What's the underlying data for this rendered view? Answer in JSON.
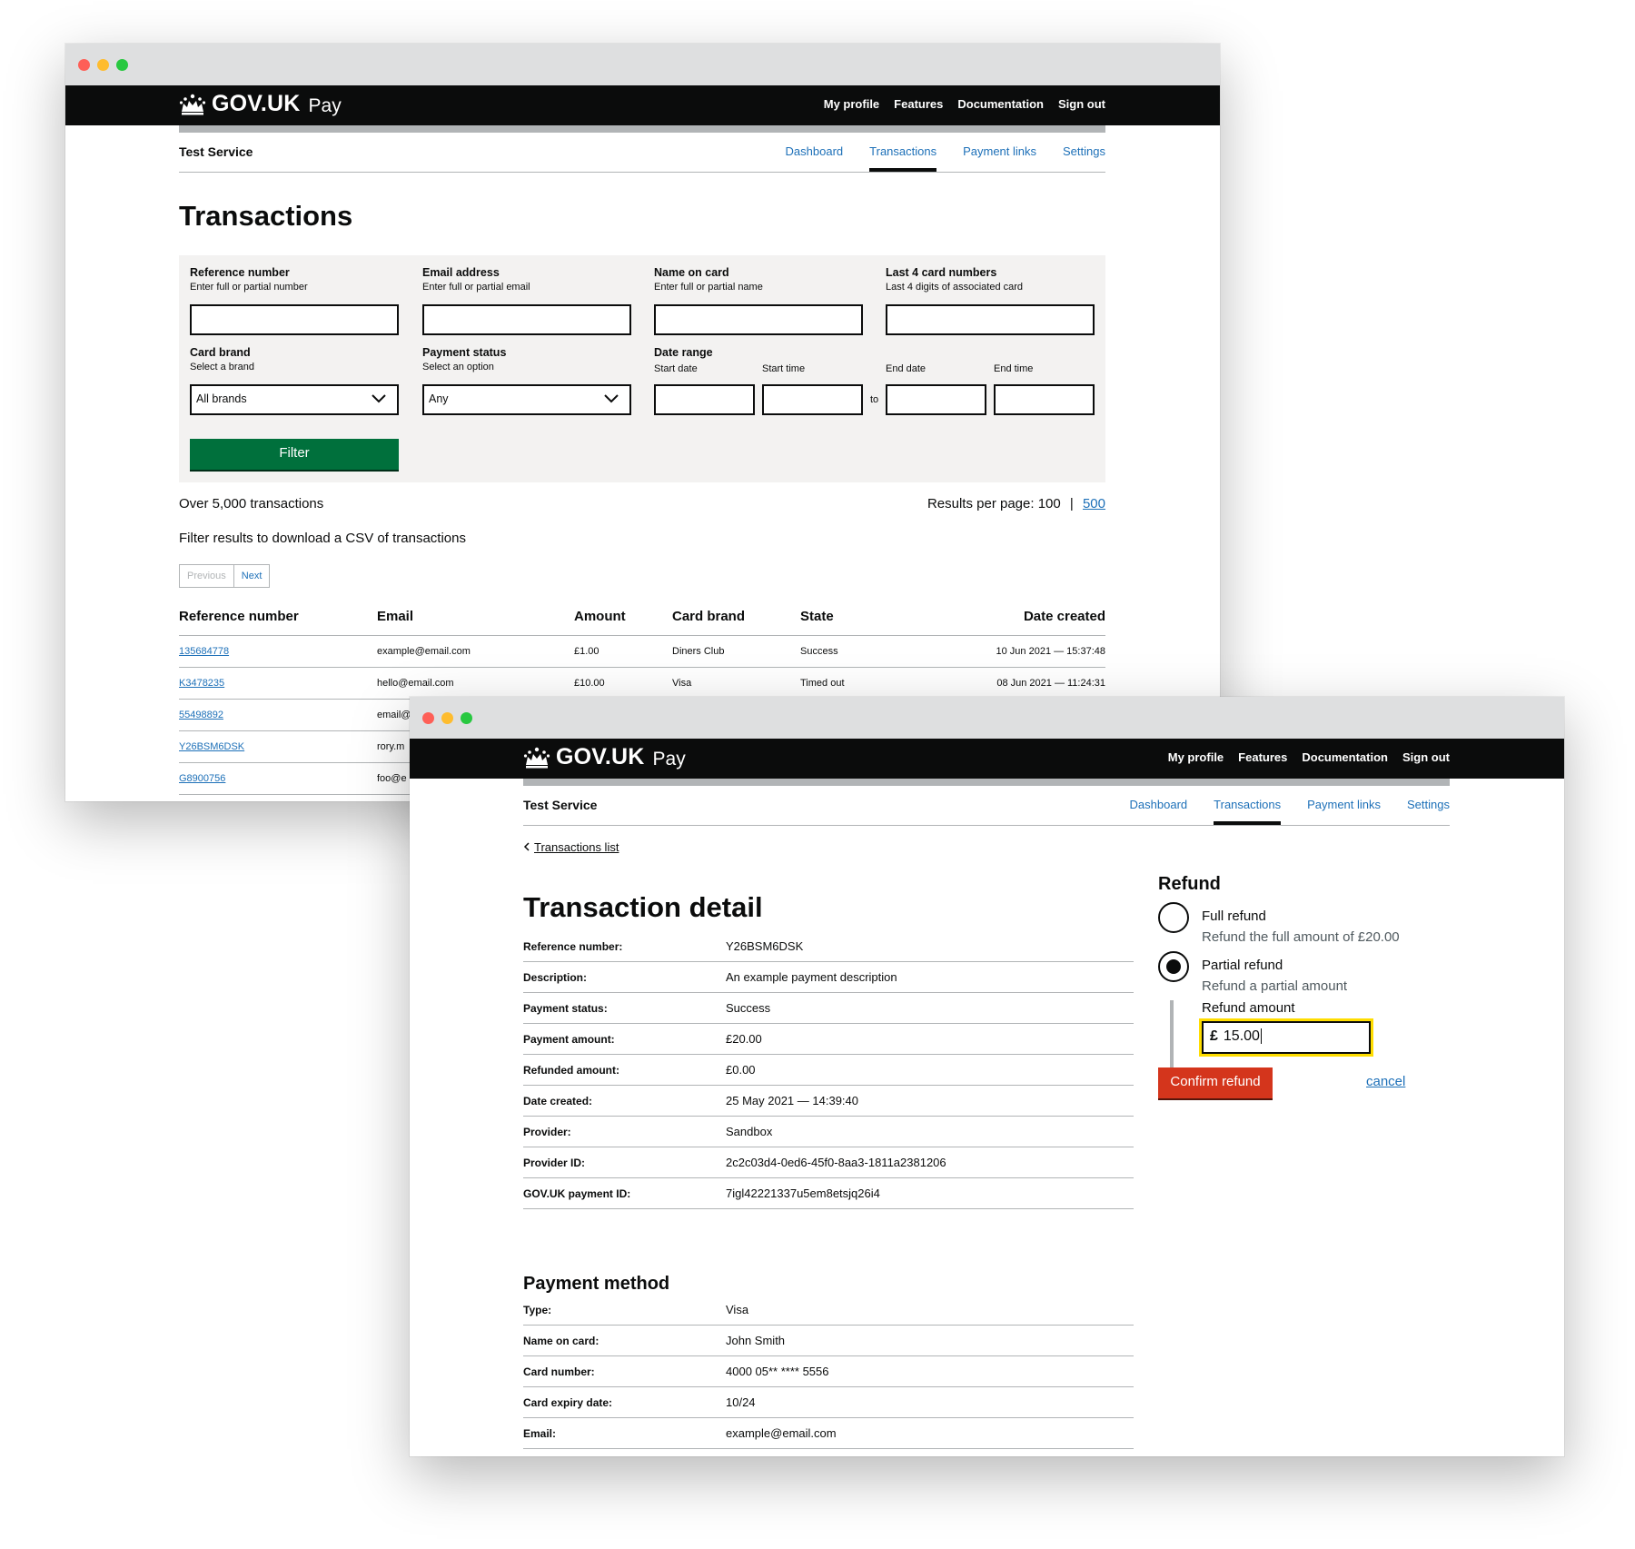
{
  "colors": {
    "gov_black": "#0b0c0c",
    "link_blue": "#1d70b8",
    "filter_green": "#00703c",
    "refund_red": "#d4351c",
    "focus_yellow": "#ffdd00",
    "panel_grey": "#f3f2f1"
  },
  "header": {
    "logo_text": "GOV.UK",
    "product_text": "Pay",
    "nav": [
      "My profile",
      "Features",
      "Documentation",
      "Sign out"
    ]
  },
  "service": {
    "name": "Test Service",
    "tabs": [
      "Dashboard",
      "Transactions",
      "Payment links",
      "Settings"
    ],
    "active_tab": "Transactions"
  },
  "transactions_page": {
    "title": "Transactions",
    "filters": {
      "reference": {
        "label": "Reference number",
        "hint": "Enter full or partial number",
        "value": ""
      },
      "email": {
        "label": "Email address",
        "hint": "Enter full or partial email",
        "value": ""
      },
      "name": {
        "label": "Name on card",
        "hint": "Enter full or partial name",
        "value": ""
      },
      "last4": {
        "label": "Last 4 card numbers",
        "hint": "Last 4 digits of associated card",
        "value": ""
      },
      "card_brand": {
        "label": "Card brand",
        "hint": "Select a brand",
        "selected": "All brands"
      },
      "payment_status": {
        "label": "Payment status",
        "hint": "Select an option",
        "selected": "Any"
      },
      "date_range": {
        "label": "Date range",
        "start_date": "Start date",
        "start_time": "Start time",
        "end_date": "End date",
        "end_time": "End time",
        "separator": "to"
      },
      "button": "Filter"
    },
    "count_text": "Over 5,000 transactions",
    "per_page_text": "Results per page: 100",
    "per_page_sep": "|",
    "per_page_alt": "500",
    "csv_text": "Filter results to download a CSV of transactions",
    "pager": {
      "previous": "Previous",
      "next": "Next"
    },
    "table": {
      "headers": [
        "Reference number",
        "Email",
        "Amount",
        "Card brand",
        "State",
        "Date created"
      ],
      "rows": [
        {
          "ref": "135684778",
          "email": "example@email.com",
          "amount": "£1.00",
          "brand": "Diners Club",
          "state": "Success",
          "date": "10 Jun 2021 — 15:37:48"
        },
        {
          "ref": "K3478235",
          "email": "hello@email.com",
          "amount": "£10.00",
          "brand": "Visa",
          "state": "Timed out",
          "date": "08 Jun 2021 — 11:24:31"
        },
        {
          "ref": "55498892",
          "email": "email@",
          "amount": "",
          "brand": "",
          "state": "",
          "date": ""
        },
        {
          "ref": "Y26BSM6DSK",
          "email": "rory.m",
          "amount": "",
          "brand": "",
          "state": "",
          "date": ""
        },
        {
          "ref": "G8900756",
          "email": "foo@e",
          "amount": "",
          "brand": "",
          "state": "",
          "date": ""
        }
      ]
    }
  },
  "detail_page": {
    "back_link": "Transactions list",
    "title": "Transaction detail",
    "rows": [
      {
        "k": "Reference number:",
        "v": "Y26BSM6DSK"
      },
      {
        "k": "Description:",
        "v": "An example payment description"
      },
      {
        "k": "Payment status:",
        "v": "Success"
      },
      {
        "k": "Payment amount:",
        "v": "£20.00"
      },
      {
        "k": "Refunded amount:",
        "v": "£0.00"
      },
      {
        "k": "Date created:",
        "v": "25 May 2021 — 14:39:40"
      },
      {
        "k": "Provider:",
        "v": "Sandbox"
      },
      {
        "k": "Provider ID:",
        "v": "2c2c03d4-0ed6-45f0-8aa3-1811a2381206"
      },
      {
        "k": "GOV.UK payment ID:",
        "v": "7igl42221337u5em8etsjq26i4"
      }
    ],
    "payment_method_title": "Payment method",
    "payment_method_rows": [
      {
        "k": "Type:",
        "v": "Visa"
      },
      {
        "k": "Name on card:",
        "v": "John Smith"
      },
      {
        "k": "Card number:",
        "v": "4000 05** **** 5556"
      },
      {
        "k": "Card expiry date:",
        "v": "10/24"
      },
      {
        "k": "Email:",
        "v": "example@email.com"
      }
    ],
    "refund": {
      "title": "Refund",
      "full_label": "Full refund",
      "full_hint": "Refund the full amount of £20.00",
      "partial_label": "Partial refund",
      "partial_hint": "Refund a partial amount",
      "selected": "partial",
      "amount_label": "Refund amount",
      "currency": "£",
      "amount_value": "15.00",
      "confirm": "Confirm refund",
      "cancel": "cancel"
    }
  }
}
